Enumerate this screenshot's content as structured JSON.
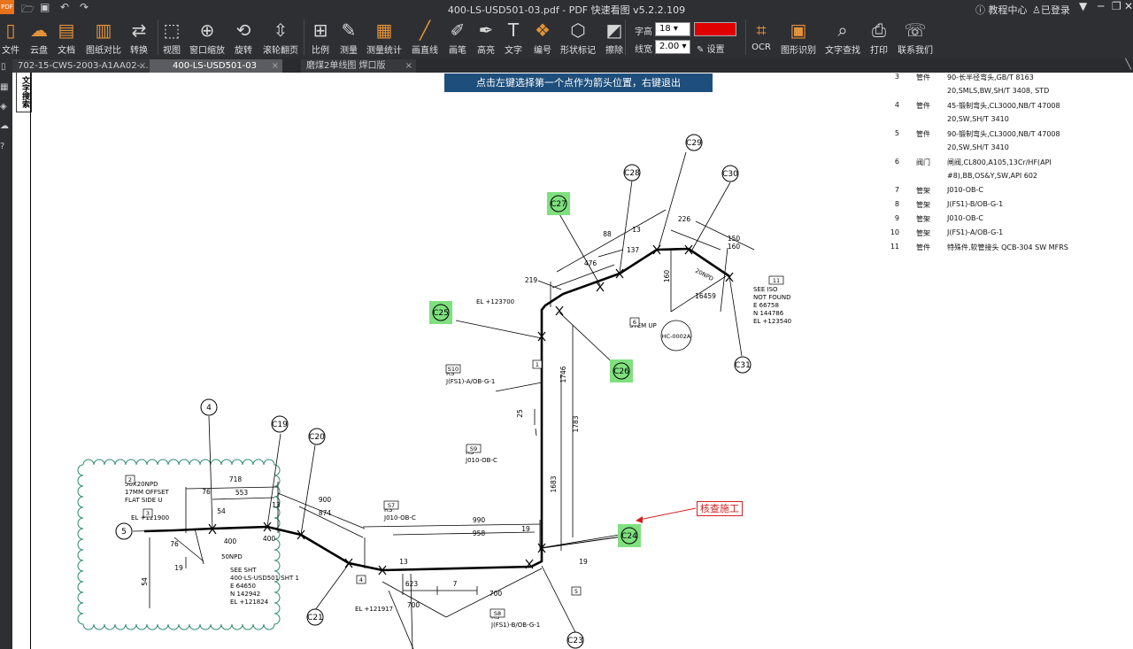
{
  "app": {
    "title": "400-LS-USD501-03.pdf - PDF 快速看图 v5.2.2.109",
    "icon": "PDF",
    "help": "教程中心",
    "login": "已登录"
  },
  "toolbar": {
    "items": [
      "文件",
      "云盘",
      "文档",
      "图纸对比",
      "转换",
      "视图",
      "窗口缩放",
      "旋转",
      "滚轮翻页",
      "比例",
      "测量",
      "测量统计",
      "画直线",
      "画笔",
      "高亮",
      "文字",
      "编号",
      "形状标记",
      "擦除",
      "OCR",
      "图形识别",
      "文字查找",
      "打印",
      "联系我们"
    ],
    "font_size_label": "字高",
    "font_size_value": "18",
    "line_width_label": "线宽",
    "line_width_value": "2.00",
    "settings_label": "设置",
    "color": "#e00000"
  },
  "tabs": [
    {
      "label": "702-15-CWS-2003-A1AA02-...",
      "active": false
    },
    {
      "label": "400-LS-USD501-03",
      "active": true
    },
    {
      "label": "磨煤2单线图 焊口版",
      "active": false
    }
  ],
  "hint": "点击左键选择第一个点作为箭头位置，右键退出",
  "side_label": "文字搜索",
  "bom": [
    {
      "no": "3",
      "cat": "管件",
      "desc": "90-长半径弯头,GB/T 8163"
    },
    {
      "no": "",
      "cat": "",
      "desc": "20,SMLS,BW,SH/T 3408, STD"
    },
    {
      "no": "4",
      "cat": "管件",
      "desc": "45-锻制弯头,CL3000,NB/T 47008"
    },
    {
      "no": "",
      "cat": "",
      "desc": "20,SW,SH/T 3410"
    },
    {
      "no": "5",
      "cat": "管件",
      "desc": "90-锻制弯头,CL3000,NB/T 47008"
    },
    {
      "no": "",
      "cat": "",
      "desc": "20,SW,SH/T 3410"
    },
    {
      "no": "6",
      "cat": "阀门",
      "desc": "闸阀,CL800,A105,13Cr/HF(API"
    },
    {
      "no": "",
      "cat": "",
      "desc": "#8),BB,OS&Y,SW,API 602"
    },
    {
      "no": "7",
      "cat": "管架",
      "desc": "J010-OB-C"
    },
    {
      "no": "8",
      "cat": "管架",
      "desc": "J(FS1)-B/OB-G-1"
    },
    {
      "no": "9",
      "cat": "管架",
      "desc": "J010-OB-C"
    },
    {
      "no": "10",
      "cat": "管架",
      "desc": "J(FS1)-A/OB-G-1"
    },
    {
      "no": "11",
      "cat": "管件",
      "desc": "特殊件,软管接头 QCB-304 SW MFRS"
    }
  ],
  "weld_labels": [
    "C19",
    "C20",
    "C21",
    "C23",
    "C24",
    "C25",
    "C26",
    "C27",
    "C28",
    "C29",
    "C30",
    "C31"
  ],
  "annotation": {
    "text": "核查施工",
    "color": "#d42020"
  },
  "drawing": {
    "component_numbers": [
      "4",
      "5"
    ],
    "dimensions": [
      "718",
      "553",
      "76",
      "54",
      "400",
      "400",
      "900",
      "874",
      "13",
      "990",
      "958",
      "19",
      "13",
      "623",
      "7",
      "700",
      "700",
      "1683",
      "1783",
      "1746",
      "25",
      "19",
      "219",
      "476",
      "88",
      "137",
      "13",
      "226",
      "150",
      "160",
      "160",
      "16459",
      "54",
      "76",
      "19"
    ],
    "notes": {
      "offset": [
        "50X20NPD",
        "17MM OFFSET",
        "FLAT SIDE U"
      ],
      "el1": "EL +121900",
      "npd": "50NPD",
      "see_sht": [
        "SEE SHT",
        "400-LS-USD501 SHT 1",
        "E 64650",
        "N 142942",
        "EL +121824"
      ],
      "s7": [
        "RS",
        "J010-OB-C"
      ],
      "s8": [
        "RS",
        "J(FS1)-B/OB-G-1"
      ],
      "s9": [
        "RS",
        "J010-OB-C"
      ],
      "s10": [
        "RS",
        "J(FS1)-A/OB-G-1"
      ],
      "el_bottom": "EL +121917",
      "el_top": "EL +123700",
      "stem_up": "STEM UP",
      "see_iso": [
        "SEE ISO",
        "NOT FOUND",
        "E 66758",
        "N 144786",
        "EL +123540"
      ],
      "hc": "HC-0002A",
      "npd20": "20NPD"
    },
    "tags": [
      "2",
      "3",
      "S7",
      "S8",
      "S9",
      "S10",
      "4",
      "5",
      "6",
      "11",
      "1"
    ]
  }
}
